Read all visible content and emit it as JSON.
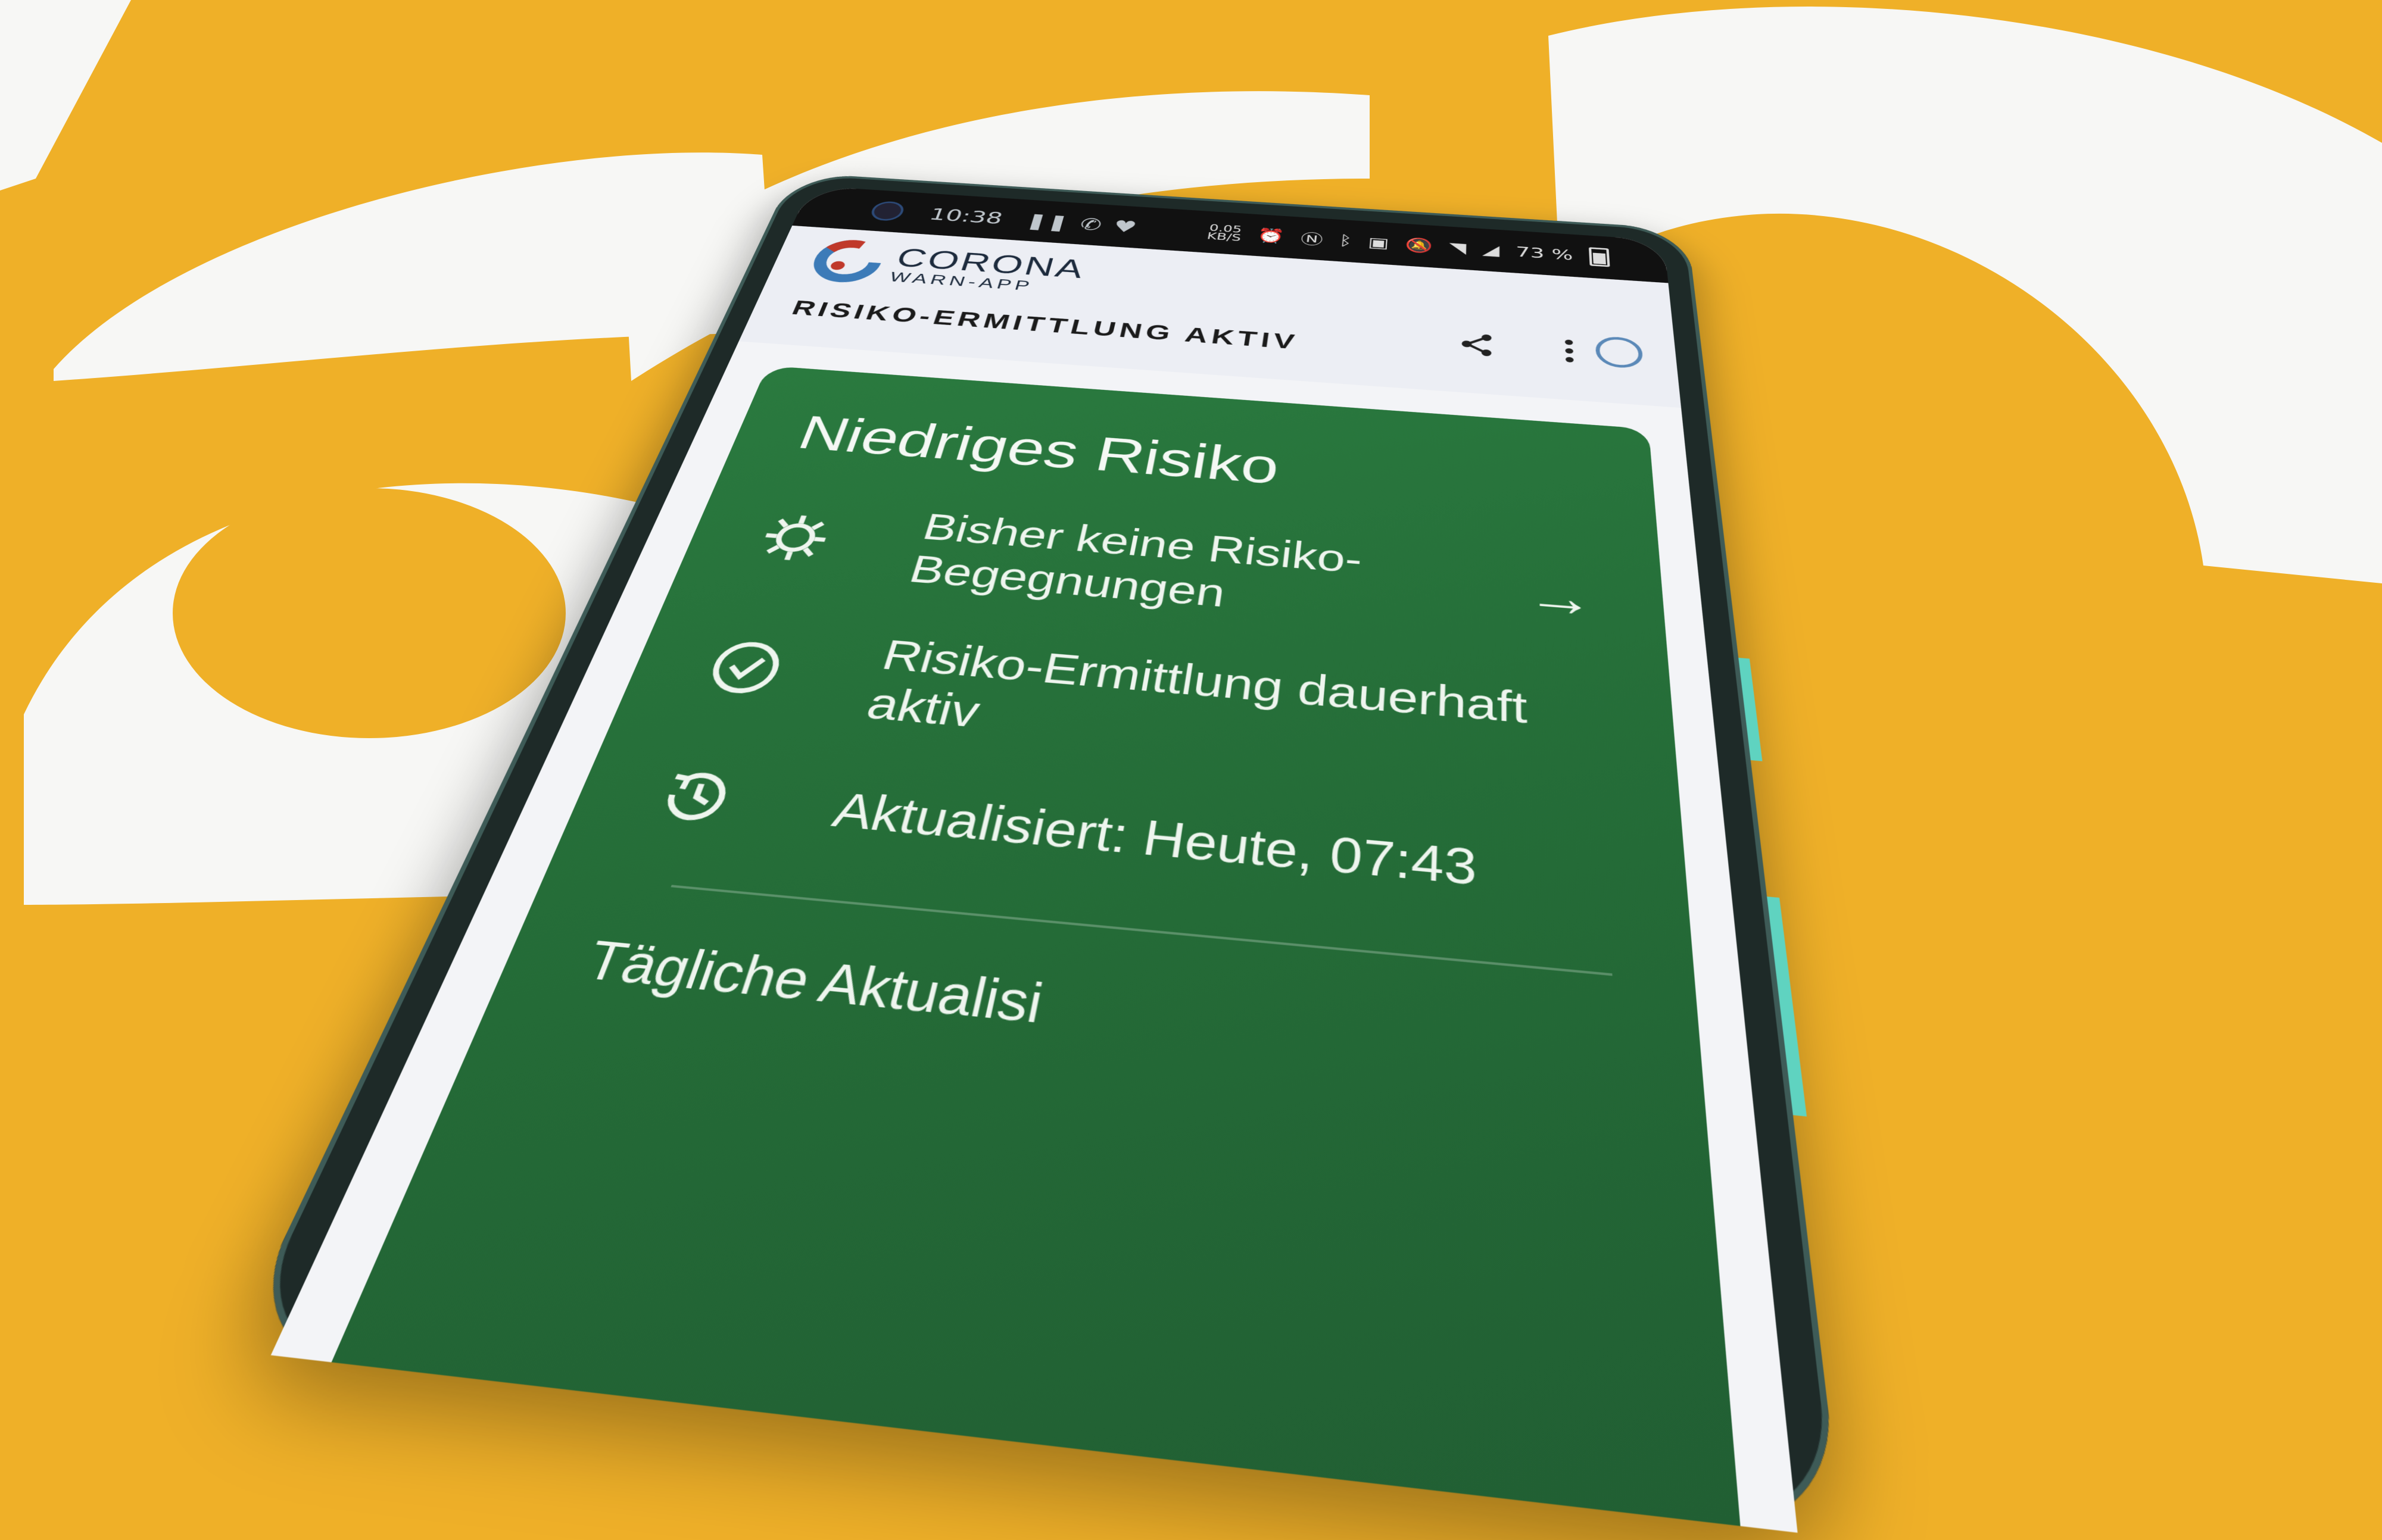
{
  "status_bar": {
    "time": "10:38",
    "net_speed_value": "0.05",
    "net_speed_unit": "KB/S",
    "battery": "73 %",
    "icons": [
      "pause-icon",
      "whatsapp-icon",
      "health-icon",
      "alarm-icon",
      "nfc-icon",
      "bluetooth-icon",
      "volte-icon",
      "mute-icon",
      "wifi-icon",
      "signal-icon",
      "battery-icon"
    ]
  },
  "app": {
    "logo_main": "CORONA",
    "logo_sub": "WARN-APP",
    "page_title": "RISIKO-ERMITTLUNG AKTIV",
    "icons": {
      "share": "share-icon",
      "more": "more-vert-icon"
    }
  },
  "card": {
    "title": "Niedriges Risiko",
    "rows": [
      {
        "icon": "virus-icon",
        "text": "Bisher keine Risiko-Begegnungen"
      },
      {
        "icon": "check-circle-icon",
        "text": "Risiko-Ermittlung dauerhaft aktiv"
      },
      {
        "icon": "history-icon",
        "text": "Aktualisiert: Heute, 07:43"
      }
    ],
    "footer": "Tägliche Aktualisi"
  },
  "colors": {
    "background": "#efb028",
    "card_green": "#2a7a3f",
    "side_button": "#5fd3c0"
  }
}
